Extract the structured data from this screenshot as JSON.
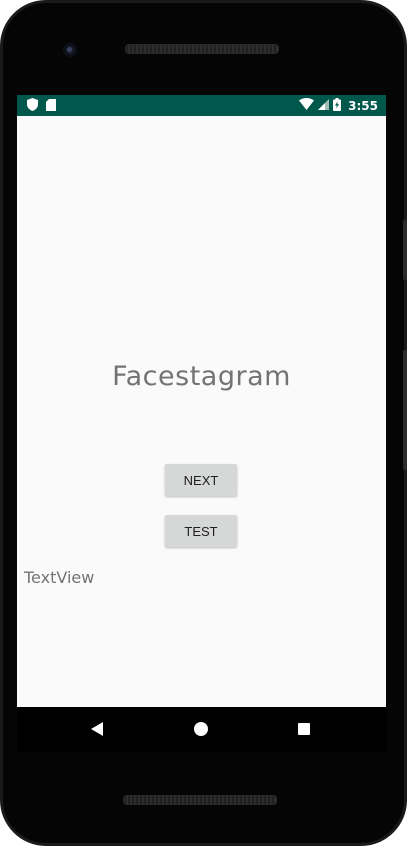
{
  "status_bar": {
    "time": "3:55",
    "background_color": "#00574b",
    "left_icons": [
      "shield-icon",
      "sd-card-icon"
    ],
    "right_icons": [
      "wifi-icon",
      "cell-signal-icon",
      "battery-charging-icon"
    ]
  },
  "main": {
    "app_title": "Facestagram",
    "next_button_label": "NEXT",
    "test_button_label": "TEST",
    "text_view": "TextView"
  },
  "nav_bar": {
    "icons": [
      "back-icon",
      "home-icon",
      "recents-icon"
    ]
  }
}
